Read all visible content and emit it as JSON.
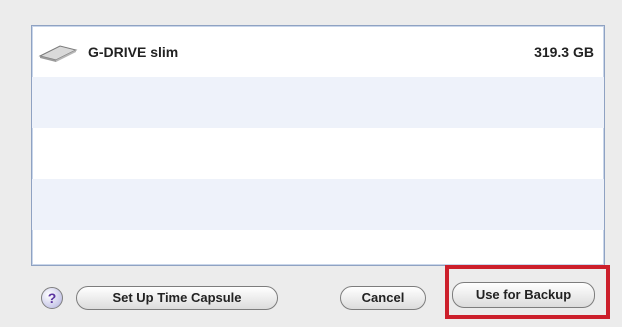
{
  "list": {
    "items": [
      {
        "name": "G-DRIVE slim",
        "size": "319.3 GB",
        "icon": "external-drive-icon"
      }
    ]
  },
  "buttons": {
    "help_label": "?",
    "setup_time_capsule": "Set Up Time Capsule",
    "cancel": "Cancel",
    "use_for_backup": "Use for Backup"
  },
  "colors": {
    "highlight": "#cc1f2b",
    "row_alt": "#eef2fa"
  }
}
